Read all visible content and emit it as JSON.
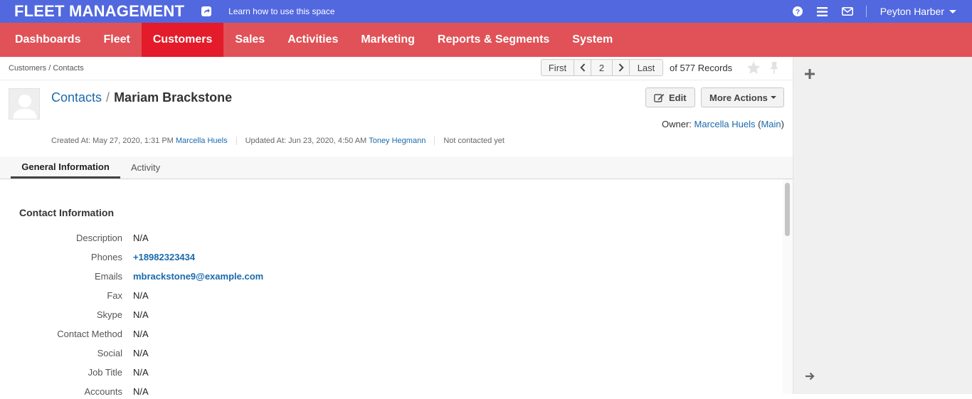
{
  "topbar": {
    "brand": "FLEET MANAGEMENT",
    "learn_link": "Learn how to use this space",
    "user_name": "Peyton Harber"
  },
  "nav": {
    "items": [
      {
        "label": "Dashboards"
      },
      {
        "label": "Fleet"
      },
      {
        "label": "Customers"
      },
      {
        "label": "Sales"
      },
      {
        "label": "Activities"
      },
      {
        "label": "Marketing"
      },
      {
        "label": "Reports & Segments"
      },
      {
        "label": "System"
      }
    ],
    "active": "Customers"
  },
  "breadcrumb": "Customers / Contacts",
  "pager": {
    "first": "First",
    "current": "2",
    "last": "Last",
    "records": "of 577 Records"
  },
  "record": {
    "entity": "Contacts",
    "separator": "/",
    "name": "Mariam Brackstone",
    "edit_label": "Edit",
    "more_actions_label": "More Actions",
    "owner_prefix": "Owner:",
    "owner_name": "Marcella Huels",
    "owner_unit": "Main",
    "created_prefix": "Created At: May 27, 2020, 1:31 PM",
    "created_by": "Marcella Huels",
    "updated_prefix": "Updated At: Jun 23, 2020, 4:50 AM",
    "updated_by": "Toney Hegmann",
    "contact_status": "Not contacted yet"
  },
  "tabs": [
    {
      "label": "General Information"
    },
    {
      "label": "Activity"
    }
  ],
  "section": {
    "title": "Contact Information",
    "fields": [
      {
        "label": "Description",
        "value": "N/A"
      },
      {
        "label": "Phones",
        "value": "+18982323434"
      },
      {
        "label": "Emails",
        "value": "mbrackstone9@example.com"
      },
      {
        "label": "Fax",
        "value": "N/A"
      },
      {
        "label": "Skype",
        "value": "N/A"
      },
      {
        "label": "Contact Method",
        "value": "N/A"
      },
      {
        "label": "Social",
        "value": "N/A"
      },
      {
        "label": "Job Title",
        "value": "N/A"
      },
      {
        "label": "Accounts",
        "value": "N/A"
      }
    ]
  },
  "colors": {
    "topbar": "#5168df",
    "navbar": "#e05257",
    "nav_active": "#e41b2a",
    "link": "#1a6aac"
  }
}
